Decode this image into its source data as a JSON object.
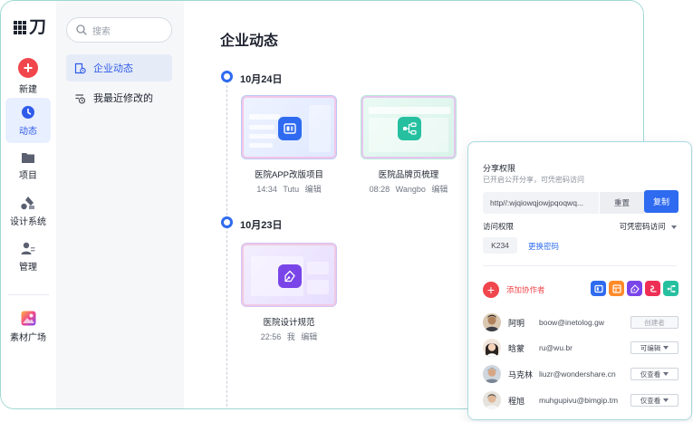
{
  "rail": {
    "logo_glyph": "刀",
    "items": [
      {
        "key": "new",
        "label": "新建",
        "icon": "plus-icon"
      },
      {
        "key": "activity",
        "label": "动态",
        "icon": "clock-icon",
        "active": true
      },
      {
        "key": "projects",
        "label": "项目",
        "icon": "folder-icon"
      },
      {
        "key": "design_system",
        "label": "设计系统",
        "icon": "design-shapes-icon"
      },
      {
        "key": "manage",
        "label": "管理",
        "icon": "user-manage-icon"
      },
      {
        "key": "assets",
        "label": "素材广场",
        "icon": "asset-square-icon"
      }
    ]
  },
  "nav": {
    "search_placeholder": "搜索",
    "items": [
      {
        "label": "企业动态",
        "icon": "company-feed-icon",
        "active": true
      },
      {
        "label": "我最近修改的",
        "icon": "recent-edit-icon"
      }
    ]
  },
  "main": {
    "title": "企业动态",
    "groups": [
      {
        "date": "10月24日",
        "cards": [
          {
            "name": "医院APP改版项目",
            "time": "14:34",
            "user": "Tutu",
            "action": "编辑",
            "icon": "prototype-app-icon"
          },
          {
            "name": "医院品牌页梳理",
            "time": "08:28",
            "user": "Wangbo",
            "action": "编辑",
            "icon": "mindmap-app-icon"
          }
        ]
      },
      {
        "date": "10月23日",
        "cards": [
          {
            "name": "医院设计规范",
            "time": "22:56",
            "user": "我",
            "action": "编辑",
            "icon": "pen-tool-app-icon"
          }
        ]
      }
    ]
  },
  "share": {
    "title": "分享权限",
    "subtitle": "已开启公开分享，可凭密码访问",
    "link": "http//:wjqiowqjowjpqoqwq...",
    "reset_label": "重置",
    "copy_label": "复制",
    "access_label": "访问权限",
    "access_value": "可凭密码访问",
    "password": "K234",
    "change_password_label": "更换密码",
    "add_collaborator_label": "添加协作者",
    "app_icons": [
      "blue-prototype-icon",
      "orange-board-icon",
      "purple-pen-icon",
      "red-link-icon",
      "green-mindmap-icon"
    ],
    "members": [
      {
        "name": "阿明",
        "email": "boow@inetolog.gw",
        "role": "创建者",
        "dropdown": false
      },
      {
        "name": "晗蒙",
        "email": "ru@wu.br",
        "role": "可编辑",
        "dropdown": true
      },
      {
        "name": "马克林",
        "email": "liuzr@wondershare.cn",
        "role": "仅查看",
        "dropdown": true
      },
      {
        "name": "程旭",
        "email": "muhgupivu@bimgip.tm",
        "role": "仅查看",
        "dropdown": true
      }
    ]
  },
  "colors": {
    "accent": "#2f6bf0",
    "danger": "#f0464c",
    "frame_border": "#9fd8d4"
  }
}
